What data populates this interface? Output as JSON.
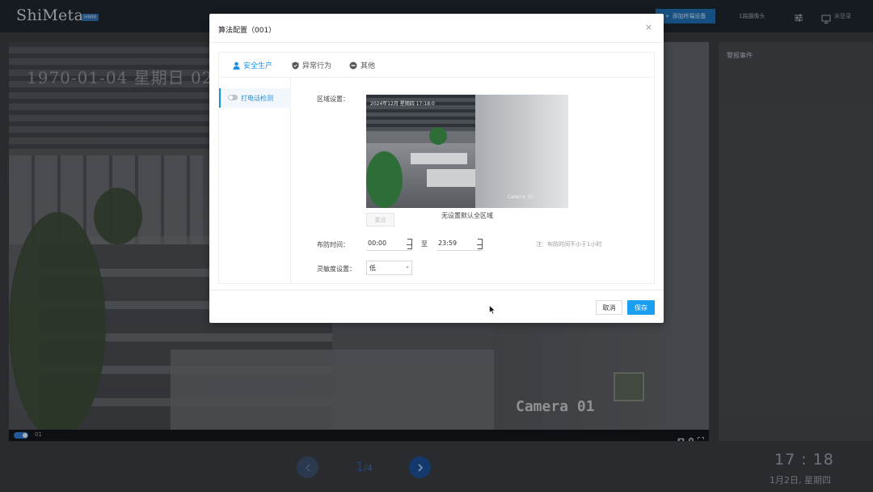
{
  "app": {
    "brand": "ShiMeta",
    "brand_badge": "HMM",
    "add_device_label": "添加终端设备",
    "camera_count": "1路摄像头",
    "login_label": "未登录"
  },
  "video": {
    "osd_date": "1970-01-04 星期日 02:",
    "osd_camera": "Camera 01",
    "channel_label": "01"
  },
  "side_panel": {
    "title": "警报事件"
  },
  "pager": {
    "current": "1",
    "total": "/4"
  },
  "clock": {
    "time": "17 : 18",
    "date": "1月2日, 星期四"
  },
  "modal": {
    "title": "算法配置（001）",
    "close": "×",
    "tabs": [
      {
        "label": "安全生产",
        "icon": "user-icon",
        "active": true
      },
      {
        "label": "异常行为",
        "icon": "shield-icon",
        "active": false
      },
      {
        "label": "其他",
        "icon": "minus-circle-icon",
        "active": false
      }
    ],
    "menu": [
      {
        "label": "打电话检测",
        "enabled": false
      }
    ],
    "form": {
      "region_label": "区域设置：",
      "preview_osd": "2024年12月 星期四 17:18:0",
      "preview_camera": "Camera 01",
      "reset_label": "重设",
      "region_hint": "无设置默认全区域",
      "time_label": "布防时间：",
      "start_time": "00:00",
      "to_label": "至",
      "end_time": "23:59",
      "time_note": "注：布防时间不小于1小时",
      "sensitivity_label": "灵敏度设置：",
      "sensitivity_value": "低"
    },
    "footer": {
      "cancel": "取消",
      "save": "保存"
    }
  },
  "colors": {
    "accent": "#1a9ff0",
    "topbar": "#1f2630",
    "active_tab": "#1891e8"
  }
}
